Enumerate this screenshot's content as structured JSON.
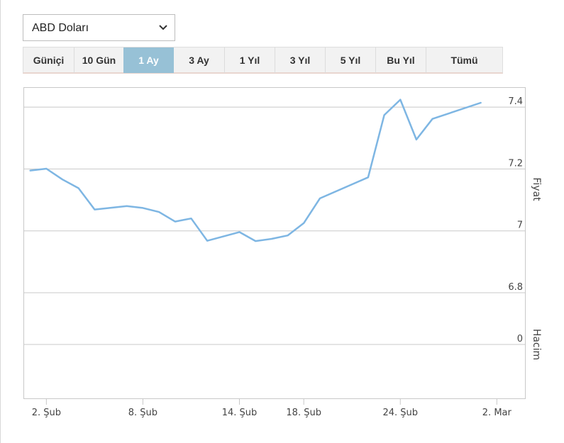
{
  "currency_select": {
    "value": "ABD Doları",
    "icon": "chevron-down-icon"
  },
  "range_tabs": [
    {
      "label": "Güniçi",
      "active": false
    },
    {
      "label": "10 Gün",
      "active": false
    },
    {
      "label": "1 Ay",
      "active": true
    },
    {
      "label": "3 Ay",
      "active": false
    },
    {
      "label": "1 Yıl",
      "active": false
    },
    {
      "label": "3 Yıl",
      "active": false
    },
    {
      "label": "5 Yıl",
      "active": false
    },
    {
      "label": "Bu Yıl",
      "active": false
    },
    {
      "label": "Tümü",
      "active": false
    }
  ],
  "colors": {
    "line": "#7eb6e3",
    "active_tab": "#97c1d6",
    "grid": "#c8c8c8"
  },
  "chart_data": {
    "type": "line",
    "y_axis_title": "Fiyat",
    "volume_axis_title": "Hacim",
    "price_ticks": [
      {
        "value": 7.4,
        "label": "7.4"
      },
      {
        "value": 7.2,
        "label": "7.2"
      },
      {
        "value": 7.0,
        "label": "7"
      },
      {
        "value": 6.8,
        "label": "6.8"
      }
    ],
    "volume_ticks": [
      {
        "value": 0,
        "label": "0"
      }
    ],
    "x_ticks": [
      {
        "label": "2. Şub",
        "date": "2021-02-02"
      },
      {
        "label": "8. Şub",
        "date": "2021-02-08"
      },
      {
        "label": "14. Şub",
        "date": "2021-02-14"
      },
      {
        "label": "18. Şub",
        "date": "2021-02-18"
      },
      {
        "label": "24. Şub",
        "date": "2021-02-24"
      },
      {
        "label": "2. Mar",
        "date": "2021-03-02"
      }
    ],
    "ylim": [
      6.8,
      7.43
    ],
    "xlim": [
      "2021-01-31",
      "2021-03-03"
    ],
    "grid": true,
    "series": [
      {
        "values": [
          {
            "x": "2021-02-01",
            "y": 7.195
          },
          {
            "x": "2021-02-02",
            "y": 7.201
          },
          {
            "x": "2021-02-03",
            "y": 7.166
          },
          {
            "x": "2021-02-04",
            "y": 7.138
          },
          {
            "x": "2021-02-05",
            "y": 7.069
          },
          {
            "x": "2021-02-07",
            "y": 7.08
          },
          {
            "x": "2021-02-08",
            "y": 7.074
          },
          {
            "x": "2021-02-09",
            "y": 7.061
          },
          {
            "x": "2021-02-10",
            "y": 7.03
          },
          {
            "x": "2021-02-11",
            "y": 7.04
          },
          {
            "x": "2021-02-12",
            "y": 6.968
          },
          {
            "x": "2021-02-14",
            "y": 6.996
          },
          {
            "x": "2021-02-15",
            "y": 6.967
          },
          {
            "x": "2021-02-16",
            "y": 6.974
          },
          {
            "x": "2021-02-17",
            "y": 6.985
          },
          {
            "x": "2021-02-18",
            "y": 7.025
          },
          {
            "x": "2021-02-19",
            "y": 7.105
          },
          {
            "x": "2021-02-22",
            "y": 7.173
          },
          {
            "x": "2021-02-23",
            "y": 7.374
          },
          {
            "x": "2021-02-24",
            "y": 7.424
          },
          {
            "x": "2021-02-25",
            "y": 7.295
          },
          {
            "x": "2021-02-26",
            "y": 7.362
          },
          {
            "x": "2021-03-01",
            "y": 7.414
          }
        ]
      }
    ]
  }
}
